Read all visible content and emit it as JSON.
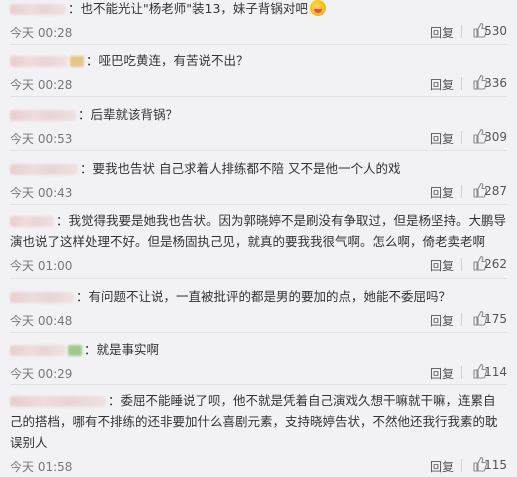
{
  "comments": [
    {
      "text": "也不能光让\"杨老师\"装13，妹子背锅对吧",
      "time": "今天 00:28",
      "reply_label": "回复",
      "likes": "530",
      "has_badge": false,
      "has_emoji": true
    },
    {
      "text": "哑巴吃黄连，有苦说不出？",
      "time": "今天 00:28",
      "reply_label": "回复",
      "likes": "336",
      "has_badge": true
    },
    {
      "text": "后辈就该背锅？",
      "time": "今天 00:53",
      "reply_label": "回复",
      "likes": "309",
      "has_badge": false
    },
    {
      "text": "要我也告状 自己求着人排练都不陪 又不是他一个人的戏",
      "time": "今天 00:43",
      "reply_label": "回复",
      "likes": "287",
      "has_badge": false
    },
    {
      "text": "我觉得我要是她我也告状。因为郭晓婷不是刷没有争取过，但是杨坚持。大鹏导演也说了这样处理不好。但是杨固执己见，就真的要我我很气啊。怎么啊，倚老卖老啊",
      "time": "今天 01:00",
      "reply_label": "回复",
      "likes": "262",
      "has_badge": false
    },
    {
      "text": "有问题不让说，一直被批评的都是男的要加的点，她能不委屈吗？",
      "time": "今天 00:48",
      "reply_label": "回复",
      "likes": "175",
      "has_badge": false
    },
    {
      "text": "就是事实啊",
      "time": "今天 00:29",
      "reply_label": "回复",
      "likes": "114",
      "has_badge": true
    },
    {
      "text": "委屈不能睡说了呗，他不就是凭着自己演戏久想干嘛就干嘛，连累自己的搭档，哪有不排练的还非要加什么喜剧元素，支持晓婷告状，不然他还我行我素的耽误别人",
      "time": "今天 01:58",
      "reply_label": "回复",
      "likes": "115",
      "has_badge": false
    }
  ],
  "colors": {
    "background": "#f2f2f5",
    "text": "#333333",
    "meta": "#777777",
    "divider": "#e2e2e6"
  },
  "icons": {
    "like": "thumbs-up-icon"
  }
}
